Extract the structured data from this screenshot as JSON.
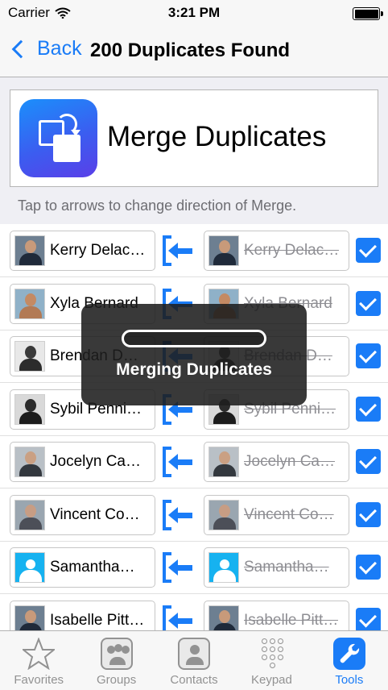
{
  "status": {
    "carrier": "Carrier",
    "time": "3:21 PM",
    "battery_level": 1.0
  },
  "nav": {
    "back_label": "Back",
    "title": "200 Duplicates Found"
  },
  "header": {
    "title": "Merge Duplicates",
    "icon": "merge-app-icon"
  },
  "hint": "Tap to arrows to change direction of Merge.",
  "rows": [
    {
      "left_name": "Kerry Delac…",
      "right_name": "Kerry Delac…",
      "checked": true,
      "direction": "left"
    },
    {
      "left_name": "Xyla Bernard",
      "right_name": "Xyla Bernard",
      "checked": true,
      "direction": "left"
    },
    {
      "left_name": "Brendan D…",
      "right_name": "Brendan D…",
      "checked": true,
      "direction": "left"
    },
    {
      "left_name": "Sybil Penni…",
      "right_name": "Sybil Penni…",
      "checked": true,
      "direction": "left"
    },
    {
      "left_name": "Jocelyn Ca…",
      "right_name": "Jocelyn Ca…",
      "checked": true,
      "direction": "left"
    },
    {
      "left_name": "Vincent Co…",
      "right_name": "Vincent Co…",
      "checked": true,
      "direction": "left"
    },
    {
      "left_name": "Samantha…",
      "right_name": "Samantha…",
      "checked": true,
      "direction": "left"
    },
    {
      "left_name": "Isabelle Pitt…",
      "right_name": "Isabelle Pitt…",
      "checked": true,
      "direction": "left"
    }
  ],
  "hud": {
    "label": "Merging Duplicates",
    "progress": 0.0
  },
  "tabs": [
    {
      "label": "Favorites",
      "icon": "star-icon",
      "active": false
    },
    {
      "label": "Groups",
      "icon": "groups-icon",
      "active": false
    },
    {
      "label": "Contacts",
      "icon": "contacts-icon",
      "active": false
    },
    {
      "label": "Keypad",
      "icon": "keypad-icon",
      "active": false
    },
    {
      "label": "Tools",
      "icon": "wrench-icon",
      "active": true
    }
  ],
  "colors": {
    "accent": "#1a7cf7",
    "background": "#efeff4",
    "tab_inactive": "#929292"
  }
}
